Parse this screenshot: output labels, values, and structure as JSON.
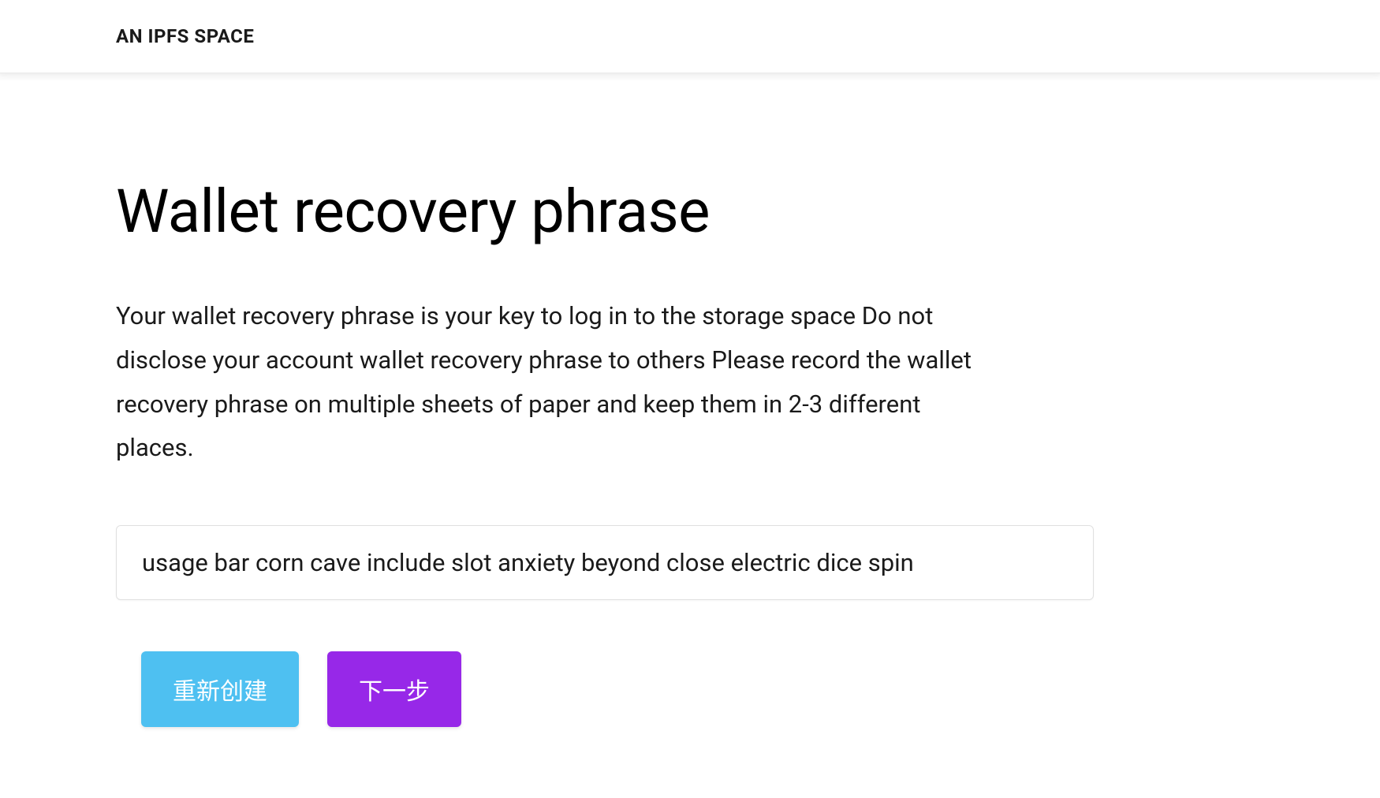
{
  "header": {
    "title": "AN IPFS SPACE"
  },
  "main": {
    "title": "Wallet recovery phrase",
    "description": "Your wallet recovery phrase is your key to log in to the storage space Do not disclose your account wallet recovery phrase to others Please record the wallet recovery phrase on multiple sheets of paper and keep them in 2-3 different places.",
    "recovery_phrase": "usage bar corn cave include slot anxiety beyond close electric dice spin"
  },
  "buttons": {
    "recreate_label": "重新创建",
    "next_label": "下一步"
  }
}
